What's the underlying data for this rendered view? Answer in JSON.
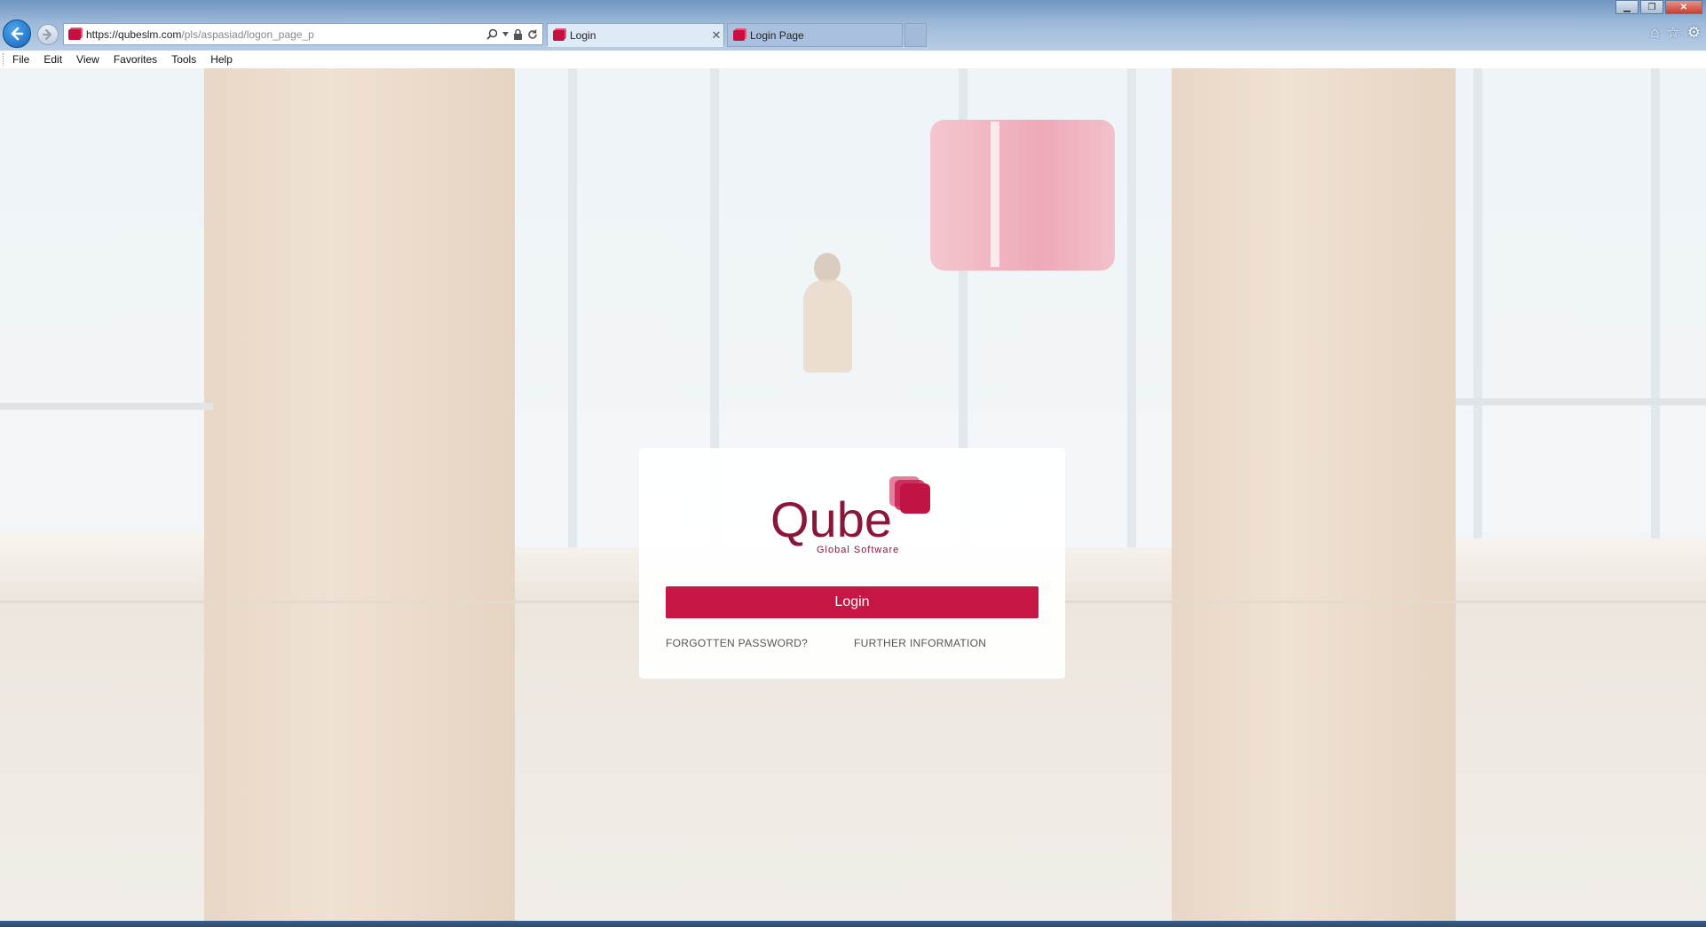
{
  "browser": {
    "url_host": "https://qubeslm.com",
    "url_path": "/pls/aspasiad/logon_page_p",
    "tabs": [
      {
        "label": "Login",
        "active": true
      },
      {
        "label": "Login Page",
        "active": false
      }
    ],
    "menu": [
      "File",
      "Edit",
      "View",
      "Favorites",
      "Tools",
      "Help"
    ],
    "icons": {
      "back": "back-arrow-icon",
      "forward": "forward-arrow-icon",
      "search": "search-icon",
      "lock": "lock-icon",
      "refresh": "refresh-icon",
      "home": "home-icon",
      "favorites": "star-icon",
      "tools": "gear-icon"
    }
  },
  "login": {
    "logo_text": "Qube",
    "logo_tagline": "Global Software",
    "button_label": "Login",
    "forgot_link": "FORGOTTEN PASSWORD?",
    "info_link": "FURTHER INFORMATION"
  },
  "colors": {
    "brand": "#c51644",
    "logo": "#8a1638"
  }
}
